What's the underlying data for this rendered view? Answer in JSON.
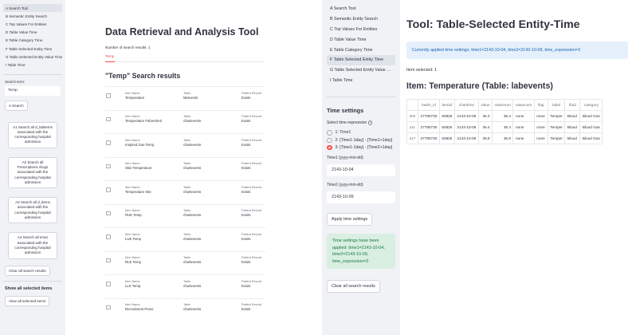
{
  "left": {
    "sidebar": {
      "nav": [
        "A Search Tool",
        "B Semantic Entity Search",
        "C Top Values For Entities",
        "D Table Value Time",
        "E Table Category Time",
        "F Table Selected Entity Time",
        "G Table Selected Entity Value Time",
        "I Table Time"
      ],
      "active_index": 0,
      "search_label": "Search term:",
      "search_value": "Temp",
      "search_button": "A Search",
      "actions": [
        "A1 Search all d_labitems associated with the corresponding hospital admission",
        "A2 Search all Prescriptions drugs associated with the corresponding hospital admission",
        "A3 Search all d_items associated with the corresponding hospital admission",
        "A4 Search all emar associated with the corresponding hospital admission"
      ],
      "clear_button": "Clear all search results",
      "selected_heading": "Show all selected items",
      "view_button": "View all selected items"
    },
    "main": {
      "title": "Data Retrieval and Analysis Tool",
      "count": "Number of search results: 1",
      "tab": "Temp",
      "subtitle": "\"Temp\" Search results",
      "col_labels": {
        "item": "Item Name",
        "table": "Table",
        "record": "Patient Record"
      },
      "rows": [
        {
          "item": "Temperature",
          "table": "labevents",
          "record": "Exists"
        },
        {
          "item": "Temperature Fahrenheit",
          "table": "chartevents",
          "record": "Exists"
        },
        {
          "item": "Inspired Gas Temp.",
          "table": "chartevents",
          "record": "Exists"
        },
        {
          "item": "Skin Temperature",
          "table": "chartevents",
          "record": "Exists"
        },
        {
          "item": "Temperature Site",
          "table": "chartevents",
          "record": "Exists"
        },
        {
          "item": "RUE Temp",
          "table": "chartevents",
          "record": "Exists"
        },
        {
          "item": "LUE Temp",
          "table": "chartevents",
          "record": "Exists"
        },
        {
          "item": "RLE Temp",
          "table": "chartevents",
          "record": "Exists"
        },
        {
          "item": "LLE Temp",
          "table": "chartevents",
          "record": "Exists"
        },
        {
          "item": "Recruitment Press",
          "table": "chartevents",
          "record": "Exists"
        }
      ]
    }
  },
  "right": {
    "sidebar": {
      "nav": [
        "A Search Tool",
        "B Semantic Entity Search",
        "C Top Values For Entities",
        "D Table Value Time",
        "E Table Category Time",
        "F Table Selected Entity Time",
        "G Table Selected Entity Value Ti...",
        "I Table Time"
      ],
      "active_index": 5,
      "time_heading": "Time settings",
      "expr_label": "Select time expression",
      "radios": [
        {
          "label": "1: Time1",
          "selected": false
        },
        {
          "label": "2: [Time1-1day] - [Time1+1day]",
          "selected": false
        },
        {
          "label": "3: [Time1-1day] - [Time2+1day]",
          "selected": true
        }
      ],
      "time1_label": "Time1 (yyyy-mm-dd)",
      "time1_value": "2143-10-04",
      "time2_label": "Time2 (yyyy-mm-dd)",
      "time2_value": "2143-10-09",
      "apply_button": "Apply time settings",
      "success": "Time settings have been applied: time1=2143-10-04, time2=2143-10-09, time_expression=3",
      "clear_button": "Clear all search results"
    },
    "main": {
      "title": "Tool: Table-Selected Entity-Time",
      "info": "Currently applied time settings: time1=2143-10-04, time2=2143-10-09, time_expression=3",
      "selected": "Item selected: 1",
      "item_title": "Item: Temperature (Table: labevents)",
      "table": {
        "headers": [
          "",
          "hadm_id",
          "itemid",
          "charttime",
          "value",
          "valuenum",
          "valueuom",
          "flag",
          "label",
          "fluid",
          "category"
        ],
        "rows": [
          [
            "202",
            "27790730",
            "50825",
            "2143-10-06",
            "36.4",
            "36.4",
            "none",
            "none",
            "Temper",
            "Blood",
            "Blood Gas"
          ],
          [
            "211",
            "27790730",
            "50825",
            "2143-10-08",
            "36.4",
            "36.4",
            "none",
            "none",
            "Temper",
            "Blood",
            "Blood Gas"
          ],
          [
            "417",
            "27790730",
            "50825",
            "2143-10-09",
            "36.8",
            "36.8",
            "none",
            "none",
            "Temper",
            "Blood",
            "Blood Gas"
          ]
        ]
      }
    }
  }
}
